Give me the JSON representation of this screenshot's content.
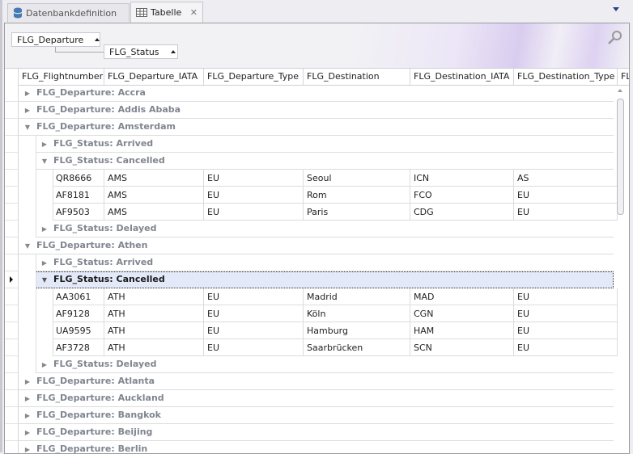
{
  "tabs": [
    {
      "label": "Datenbankdefinition",
      "icon": "database-icon",
      "active": false
    },
    {
      "label": "Tabelle",
      "icon": "table-icon",
      "active": true
    }
  ],
  "group_panel": {
    "chips": [
      "FLG_Departure",
      "FLG_Status"
    ]
  },
  "columns": [
    "FLG_Flightnumber",
    "FLG_Departure_IATA",
    "FLG_Departure_Type",
    "FLG_Destination",
    "FLG_Destination_IATA",
    "FLG_Destination_Type",
    "FLG_"
  ],
  "rows": [
    {
      "type": "group",
      "level": 1,
      "label": "FLG_Departure: Accra",
      "expanded": false
    },
    {
      "type": "group",
      "level": 1,
      "label": "FLG_Departure: Addis Ababa",
      "expanded": false
    },
    {
      "type": "group",
      "level": 1,
      "label": "FLG_Departure: Amsterdam",
      "expanded": true
    },
    {
      "type": "group",
      "level": 2,
      "label": "FLG_Status: Arrived",
      "expanded": false
    },
    {
      "type": "group",
      "level": 2,
      "label": "FLG_Status: Cancelled",
      "expanded": true
    },
    {
      "type": "data",
      "cells": [
        "QR8666",
        "AMS",
        "EU",
        "Seoul",
        "ICN",
        "AS"
      ]
    },
    {
      "type": "data",
      "cells": [
        "AF8181",
        "AMS",
        "EU",
        "Rom",
        "FCO",
        "EU"
      ]
    },
    {
      "type": "data",
      "cells": [
        "AF9503",
        "AMS",
        "EU",
        "Paris",
        "CDG",
        "EU"
      ]
    },
    {
      "type": "group",
      "level": 2,
      "label": "FLG_Status: Delayed",
      "expanded": false
    },
    {
      "type": "group",
      "level": 1,
      "label": "FLG_Departure: Athen",
      "expanded": true
    },
    {
      "type": "group",
      "level": 2,
      "label": "FLG_Status: Arrived",
      "expanded": false
    },
    {
      "type": "group",
      "level": 2,
      "label": "FLG_Status: Cancelled",
      "expanded": true,
      "selected": true
    },
    {
      "type": "data",
      "cells": [
        "AA3061",
        "ATH",
        "EU",
        "Madrid",
        "MAD",
        "EU"
      ]
    },
    {
      "type": "data",
      "cells": [
        "AF9128",
        "ATH",
        "EU",
        "Köln",
        "CGN",
        "EU"
      ]
    },
    {
      "type": "data",
      "cells": [
        "UA9595",
        "ATH",
        "EU",
        "Hamburg",
        "HAM",
        "EU"
      ]
    },
    {
      "type": "data",
      "cells": [
        "AF3728",
        "ATH",
        "EU",
        "Saarbrücken",
        "SCN",
        "EU"
      ]
    },
    {
      "type": "group",
      "level": 2,
      "label": "FLG_Status: Delayed",
      "expanded": false
    },
    {
      "type": "group",
      "level": 1,
      "label": "FLG_Departure: Atlanta",
      "expanded": false
    },
    {
      "type": "group",
      "level": 1,
      "label": "FLG_Departure: Auckland",
      "expanded": false
    },
    {
      "type": "group",
      "level": 1,
      "label": "FLG_Departure: Bangkok",
      "expanded": false
    },
    {
      "type": "group",
      "level": 1,
      "label": "FLG_Departure: Beijing",
      "expanded": false
    },
    {
      "type": "group",
      "level": 1,
      "label": "FLG_Departure: Berlin",
      "expanded": false
    }
  ]
}
